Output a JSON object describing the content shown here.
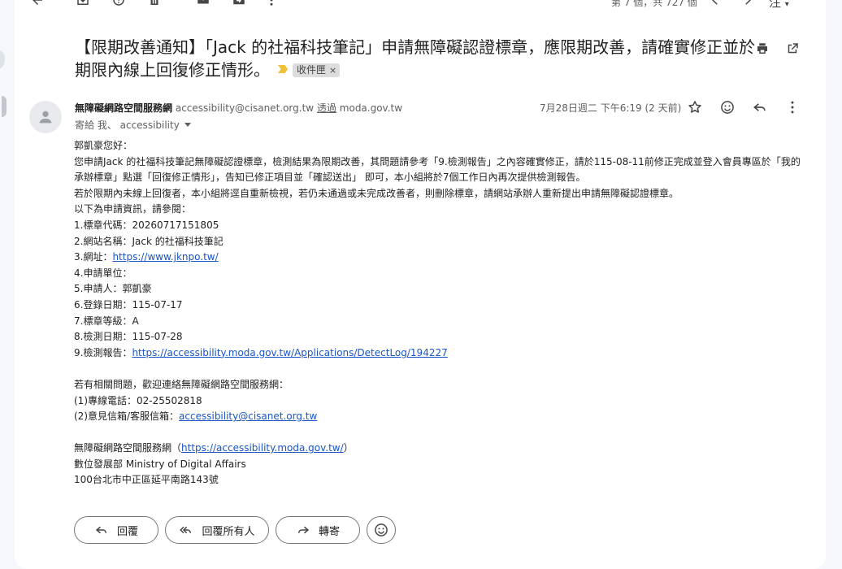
{
  "toolbar": {
    "pager_text": "第 7 個，共 727 個",
    "lang_label": "注"
  },
  "subject": {
    "title": "【限期改善通知】「Jack 的社福科技筆記」申請無障礙認證標章，應限期改善，請確實修正並於期限內線上回復修正情形。",
    "label": "收件匣",
    "label_remove": "×"
  },
  "sender": {
    "name": "無障礙網路空間服務網",
    "email": "accessibility@cisanet.org.tw",
    "via_label": "透過",
    "via_domain": "moda.gov.tw",
    "to_line": "寄給 我、 accessibility",
    "date": "7月28日週二 下午6:19 (2 天前)"
  },
  "body": {
    "greeting": "郭凱豪您好：",
    "para1": "您申請Jack 的社福科技筆記無障礙認證標章，檢測結果為限期改善，其問題請參考「9.檢測報告」之內容確實修正，請於115-08-11前修正完成並登入會員專區於「我的承辦標章」點選「回復修正情形」，告知已修正項目並「確認送出」 即可，本小組將於7個工作日內再次提供檢測報告。",
    "para2": "若於限期內未線上回復者，本小組將逕自重新檢視，若仍未通過或未完成改善者，則刪除標章，請網站承辦人重新提出申請無障礙認證標章。",
    "intro": "以下為申請資訊，請參閱：",
    "item1": "1.標章代碼：20260717151805",
    "item2": "2.網站名稱：Jack 的社福科技筆記",
    "item3_label": "3.網址：",
    "item3_link": "https://www.jknpo.tw/",
    "item4": "4.申請單位：",
    "item5": "5.申請人：郭凱豪",
    "item6": "6.登錄日期：115-07-17",
    "item7": "7.標章等級：A",
    "item8": "8.檢測日期：115-07-28",
    "item9_label": "9.檢測報告：",
    "item9_link": "https://accessibility.moda.gov.tw/Applications/DetectLog/194227",
    "contact_intro": "若有相關問題，歡迎連絡無障礙網路空間服務網：",
    "contact_phone": "(1)專線電話：02-25502818",
    "contact_mail_label": "(2)意見信箱/客服信箱：",
    "contact_mail_link": "accessibility@cisanet.org.tw",
    "sig_name": "無障礙網路空間服務網（",
    "sig_link": "https://accessibility.moda.gov.tw/",
    "sig_close": "）",
    "sig_org": "數位發展部 Ministry of Digital Affairs",
    "sig_addr": "100台北市中正區延平南路143號"
  },
  "actions": {
    "reply": "回覆",
    "reply_all": "回覆所有人",
    "forward": "轉寄"
  }
}
